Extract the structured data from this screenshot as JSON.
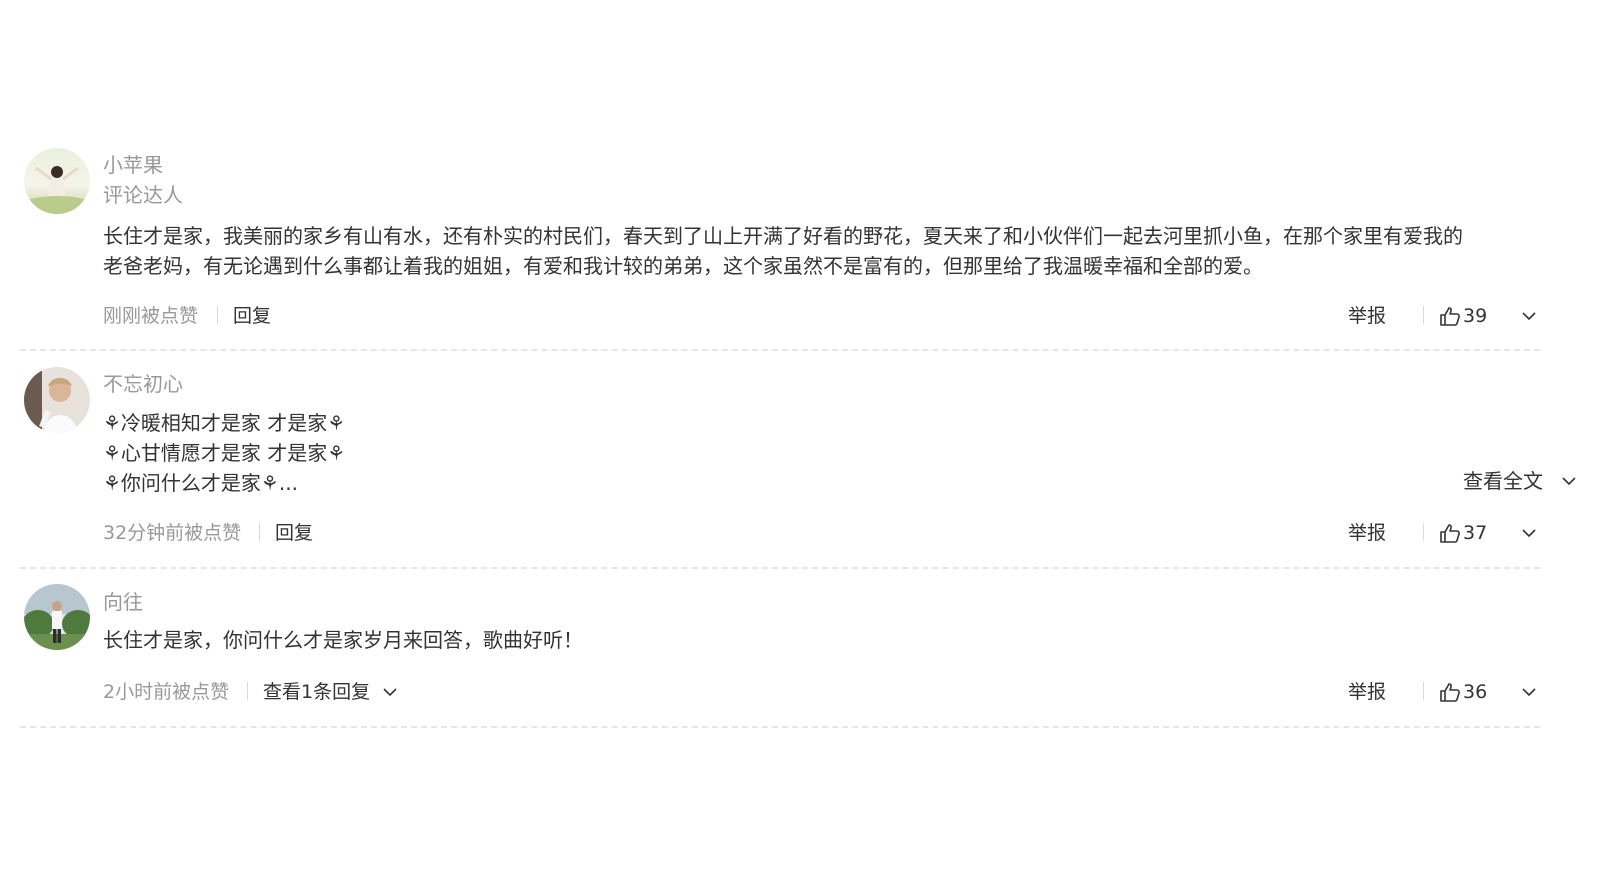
{
  "comments": [
    {
      "username": "小苹果",
      "badge": "评论达人",
      "lines": [
        "长住才是家，我美丽的家乡有山有水，还有朴实的村民们，春天到了山上开满了好看的野花，夏天来了和小伙伴们一起去河里抓小鱼，在那个家里有爱我的",
        "老爸老妈，有无论遇到什么事都让着我的姐姐，有爱和我计较的弟弟，这个家虽然不是富有的，但那里给了我温暖幸福和全部的爱。"
      ],
      "liked_time": "刚刚被点赞",
      "reply_label": "回复",
      "report_label": "举报",
      "like_count": "39"
    },
    {
      "username": "不忘初心",
      "lines": [
        "⚘冷暖相知才是家 才是家⚘",
        "⚘心甘情愿才是家 才是家⚘",
        "⚘你问什么才是家⚘..."
      ],
      "expand_label": "查看全文",
      "liked_time": "32分钟前被点赞",
      "reply_label": "回复",
      "report_label": "举报",
      "like_count": "37"
    },
    {
      "username": "向往",
      "lines": [
        "长住才是家，你问什么才是家岁月来回答，歌曲好听！"
      ],
      "liked_time": "2小时前被点赞",
      "reply_label": "查看1条回复",
      "report_label": "举报",
      "like_count": "36"
    }
  ],
  "icons": {
    "like": "thumbs-up-icon",
    "expand": "chevron-down-icon"
  },
  "colors": {
    "meta_text": "#999999",
    "body_text": "#333333",
    "divider": "#e6e6e6"
  }
}
